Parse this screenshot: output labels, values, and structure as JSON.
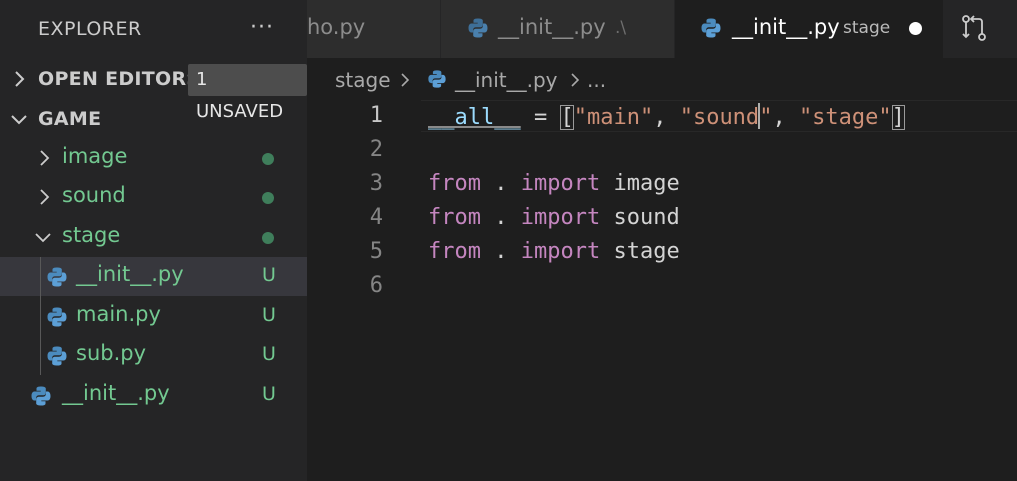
{
  "sidebar": {
    "title": "EXPLORER",
    "more_label": "···",
    "open_editors": {
      "label": "OPEN EDITORS",
      "badge": "1 UNSAVED"
    },
    "folder": {
      "label": "GAME"
    },
    "tree": [
      {
        "name": "image",
        "kind": "folder",
        "expanded": false,
        "status": ""
      },
      {
        "name": "sound",
        "kind": "folder",
        "expanded": false,
        "status": ""
      },
      {
        "name": "stage",
        "kind": "folder",
        "expanded": true,
        "status": ""
      },
      {
        "name": "__init__.py",
        "kind": "file",
        "status": "U",
        "selected": true
      },
      {
        "name": "main.py",
        "kind": "file",
        "status": "U"
      },
      {
        "name": "sub.py",
        "kind": "file",
        "status": "U"
      },
      {
        "name": "__init__.py",
        "kind": "file",
        "status": "U"
      }
    ]
  },
  "tabs": [
    {
      "label": "ho.py",
      "desc": "",
      "active": false
    },
    {
      "label": "__init__.py",
      "desc": ".\\",
      "active": false
    },
    {
      "label": "__init__.py",
      "desc": "stage",
      "active": true,
      "unsaved": true
    }
  ],
  "breadcrumb": {
    "items": [
      "stage",
      "__init__.py",
      "..."
    ]
  },
  "editor": {
    "line_numbers": [
      "1",
      "2",
      "3",
      "4",
      "5",
      "6"
    ],
    "current_line": 1,
    "lines": {
      "l1": {
        "var": "__all__",
        "eq": " = ",
        "open": "[",
        "s1": "\"main\"",
        "c1": ", ",
        "s2a": "\"sound",
        "s2b": "\"",
        "c2": ", ",
        "s3": "\"stage\"",
        "close": "]"
      },
      "l3": {
        "kw1": "from",
        "dot": " . ",
        "kw2": "import",
        "mod": " image"
      },
      "l4": {
        "kw1": "from",
        "dot": " . ",
        "kw2": "import",
        "mod": " sound"
      },
      "l5": {
        "kw1": "from",
        "dot": " . ",
        "kw2": "import",
        "mod": " stage"
      }
    }
  },
  "colors": {
    "untracked_green": "#73c991",
    "keyword": "#c586c0",
    "string": "#ce9178",
    "variable": "#9cdcfe"
  },
  "icons": {
    "python_file": "python-icon",
    "chevron_right": "chevron-right-icon",
    "chevron_down": "chevron-down-icon",
    "source_control": "source-control-icon"
  }
}
